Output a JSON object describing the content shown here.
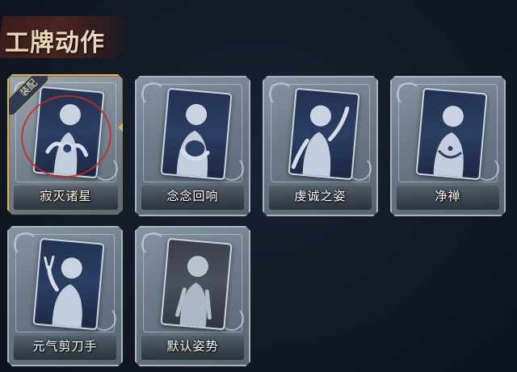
{
  "header": {
    "title": "工牌动作"
  },
  "badge": {
    "equipped_label": "装配"
  },
  "cards": [
    {
      "name": "寂灭诸星",
      "equipped": true,
      "icon": "silhouette-hands-heart-icon"
    },
    {
      "name": "念念回响",
      "equipped": false,
      "icon": "silhouette-hug-icon"
    },
    {
      "name": "虔诚之姿",
      "equipped": false,
      "icon": "silhouette-wave-icon"
    },
    {
      "name": "净禅",
      "equipped": false,
      "icon": "silhouette-meditate-icon"
    },
    {
      "name": "元气剪刀手",
      "equipped": false,
      "icon": "silhouette-peace-sign-icon"
    },
    {
      "name": "默认姿势",
      "equipped": false,
      "icon": "silhouette-default-icon"
    }
  ],
  "colors": {
    "equipped_border": "#d8b560",
    "card_bg": "#6e7c8a",
    "annotation_red": "#c82828"
  }
}
